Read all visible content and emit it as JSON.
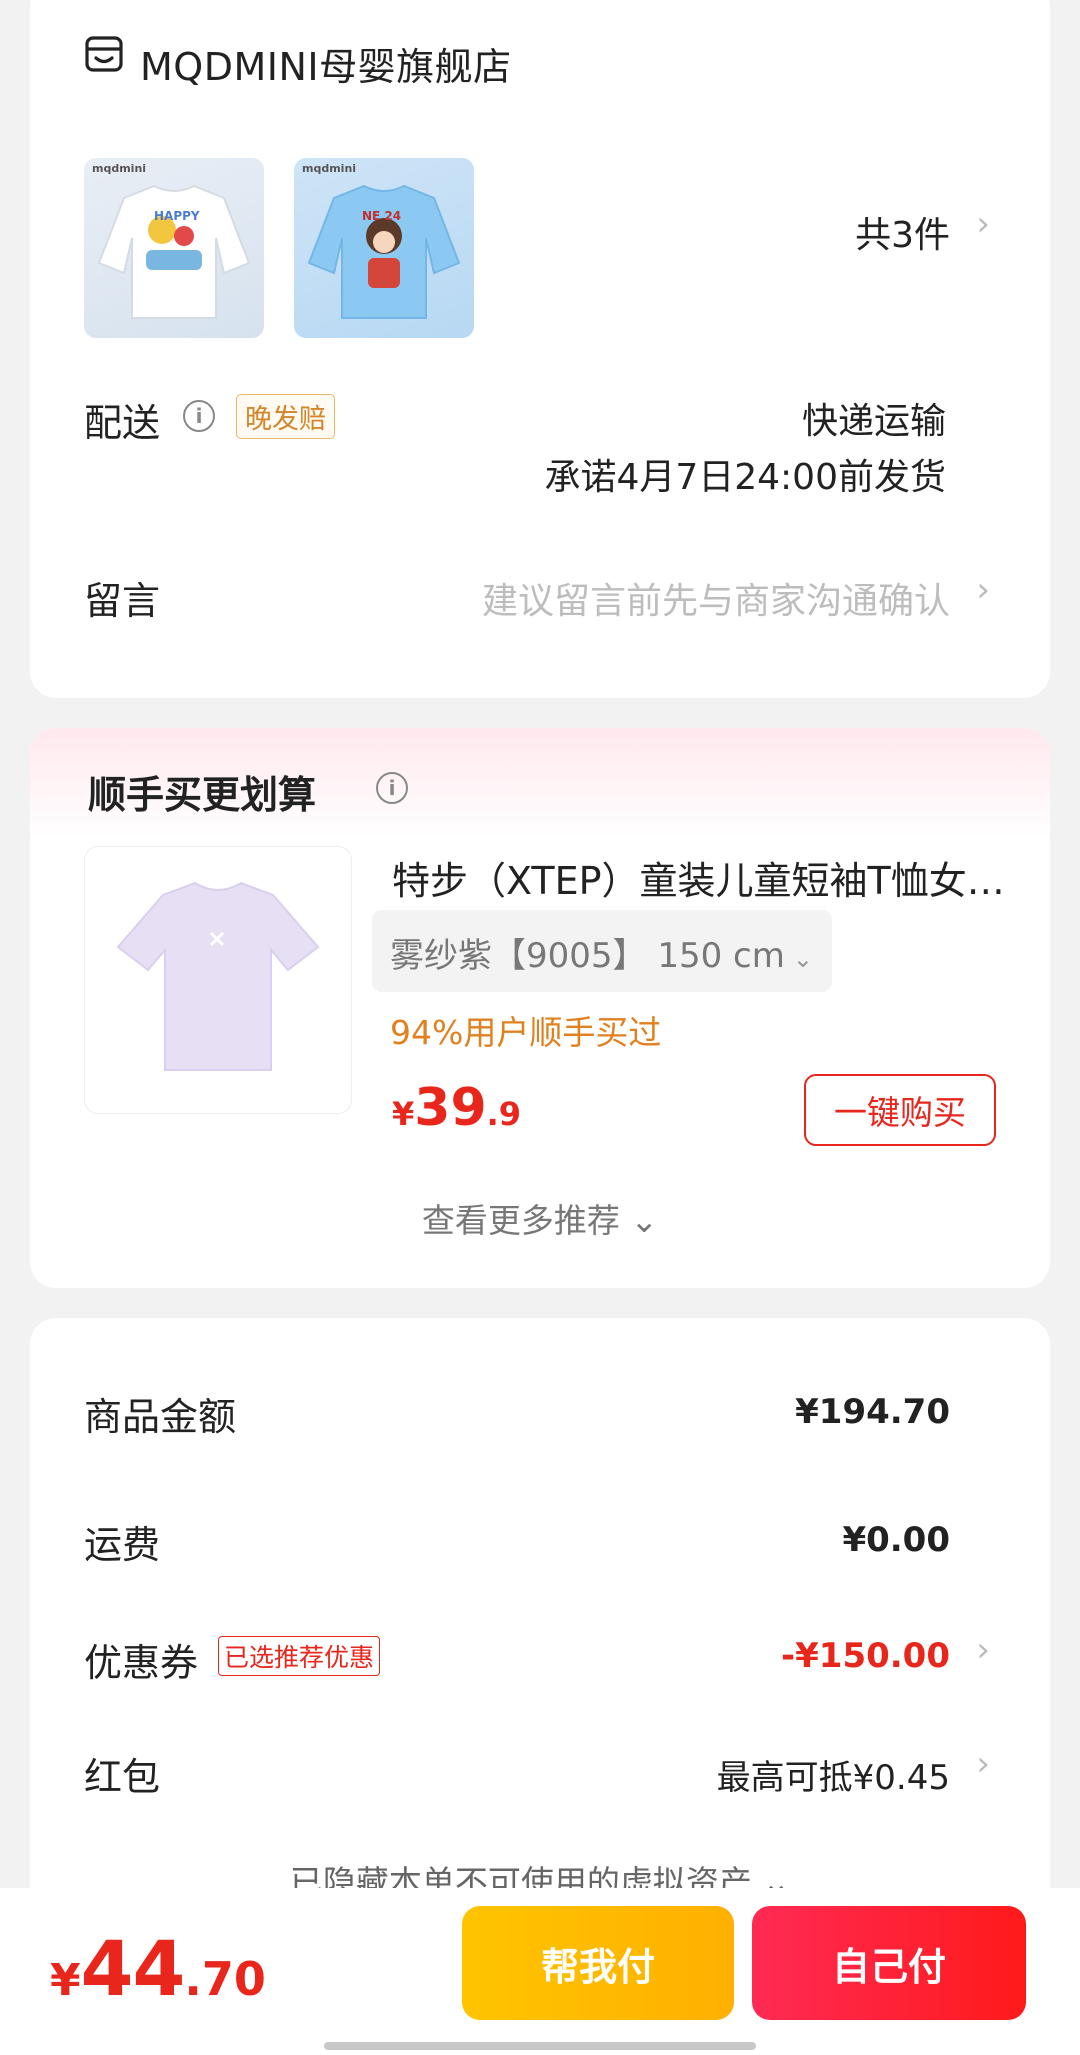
{
  "store": {
    "name": "MQDMINI母婴旗舰店",
    "thumbnails": [
      {
        "brand": "mqdmini",
        "tag": "HAPPY"
      },
      {
        "brand": "mqdmini",
        "tag": "NE 24"
      }
    ],
    "item_count": "共3件"
  },
  "delivery": {
    "label": "配送",
    "badge": "晚发赔",
    "method": "快递运输",
    "promise": "承诺4月7日24:00前发货"
  },
  "message": {
    "label": "留言",
    "placeholder": "建议留言前先与商家沟通确认"
  },
  "recommend": {
    "title": "顺手买更划算",
    "product_name": "特步（XTEP）童装儿童短袖T恤女童夏季",
    "variant": "雾纱紫【9005】 150 cm",
    "stat": "94%用户顺手买过",
    "price_currency": "¥",
    "price_int": "39",
    "price_dec": ".9",
    "buy_button": "一键购买",
    "more": "查看更多推荐"
  },
  "pricing": {
    "goods_label": "商品金额",
    "goods_value": "¥194.70",
    "shipping_label": "运费",
    "shipping_value": "¥0.00",
    "coupon_label": "优惠券",
    "coupon_badge": "已选推荐优惠",
    "coupon_value": "-¥150.00",
    "redpacket_label": "红包",
    "redpacket_value": "最高可抵¥0.45",
    "hidden_note": "已隐藏本单不可使用的虚拟资产"
  },
  "bottom": {
    "currency": "¥",
    "total_int": "44",
    "total_dec": ".70",
    "help_pay": "帮我付",
    "self_pay": "自己付"
  },
  "colors": {
    "accent_red": "#e8261c",
    "help_yellow": "#ffb800",
    "pay_red": "#ff1f3d",
    "stat_orange": "#e0801e"
  }
}
